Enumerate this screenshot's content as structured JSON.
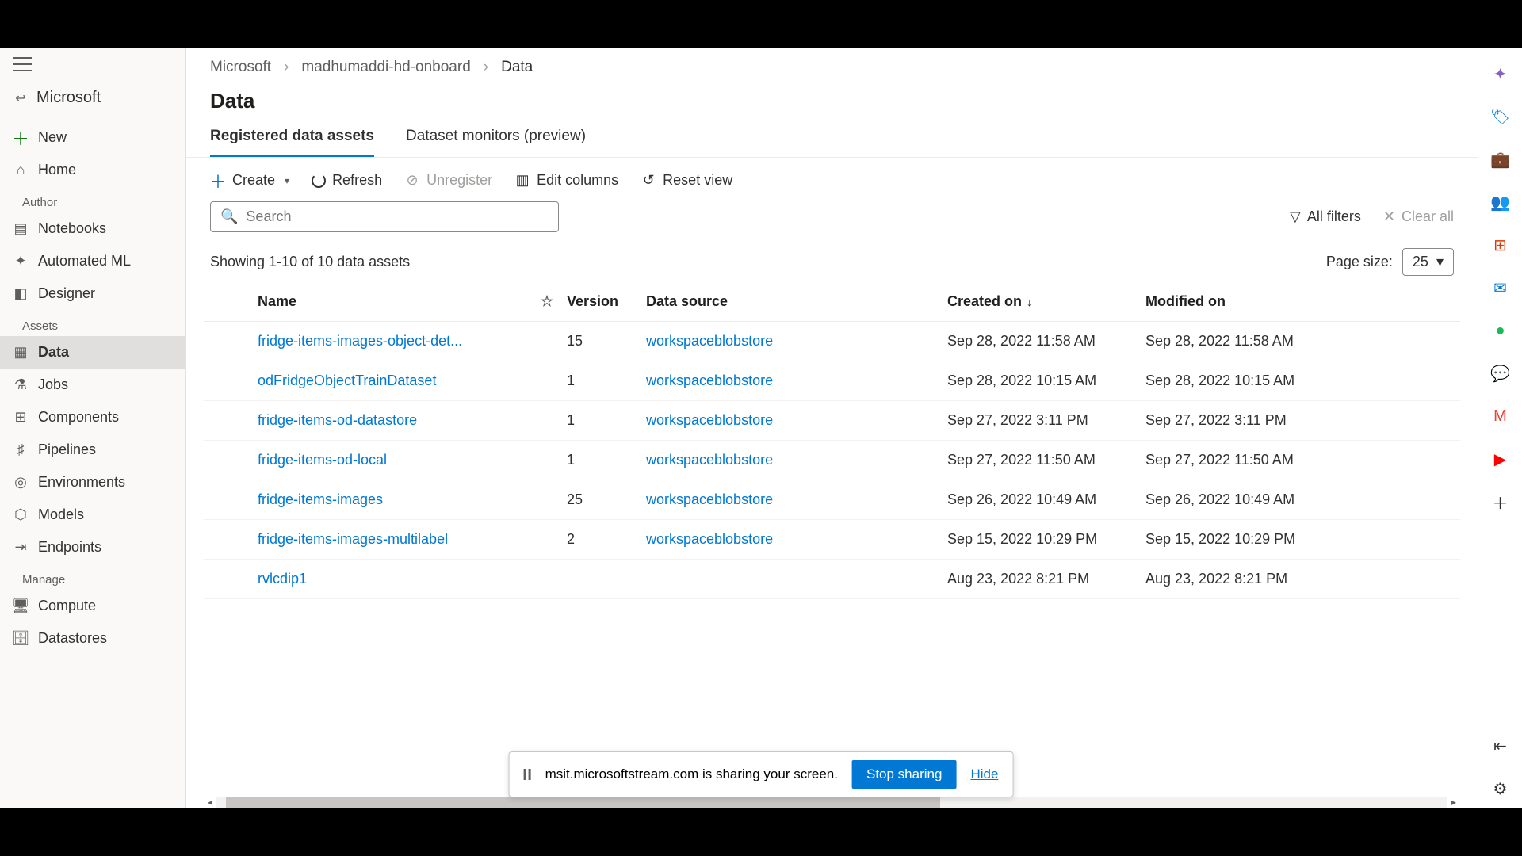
{
  "org": "Microsoft",
  "breadcrumb": {
    "root": "Microsoft",
    "workspace": "madhumaddi-hd-onboard",
    "current": "Data"
  },
  "page_title": "Data",
  "tabs": {
    "t0": "Registered data assets",
    "t1": "Dataset monitors (preview)"
  },
  "toolbar": {
    "create": "Create",
    "refresh": "Refresh",
    "unregister": "Unregister",
    "edit_columns": "Edit columns",
    "reset_view": "Reset view"
  },
  "search": {
    "placeholder": "Search"
  },
  "filters": {
    "all": "All filters",
    "clear": "Clear all"
  },
  "count_text": "Showing 1-10 of 10 data assets",
  "pagesize": {
    "label": "Page size:",
    "value": "25"
  },
  "columns": {
    "name": "Name",
    "version": "Version",
    "datasource": "Data source",
    "created": "Created on",
    "modified": "Modified on"
  },
  "rows": [
    {
      "name": "fridge-items-images-object-det...",
      "version": "15",
      "ds": "workspaceblobstore",
      "created": "Sep 28, 2022 11:58 AM",
      "modified": "Sep 28, 2022 11:58 AM"
    },
    {
      "name": "odFridgeObjectTrainDataset",
      "version": "1",
      "ds": "workspaceblobstore",
      "created": "Sep 28, 2022 10:15 AM",
      "modified": "Sep 28, 2022 10:15 AM"
    },
    {
      "name": "fridge-items-od-datastore",
      "version": "1",
      "ds": "workspaceblobstore",
      "created": "Sep 27, 2022 3:11 PM",
      "modified": "Sep 27, 2022 3:11 PM"
    },
    {
      "name": "fridge-items-od-local",
      "version": "1",
      "ds": "workspaceblobstore",
      "created": "Sep 27, 2022 11:50 AM",
      "modified": "Sep 27, 2022 11:50 AM"
    },
    {
      "name": "fridge-items-images",
      "version": "25",
      "ds": "workspaceblobstore",
      "created": "Sep 26, 2022 10:49 AM",
      "modified": "Sep 26, 2022 10:49 AM"
    },
    {
      "name": "fridge-items-images-multilabel",
      "version": "2",
      "ds": "workspaceblobstore",
      "created": "Sep 15, 2022 10:29 PM",
      "modified": "Sep 15, 2022 10:29 PM"
    },
    {
      "name": "rvlcdip1",
      "version": "",
      "ds": "",
      "created": "Aug 23, 2022 8:21 PM",
      "modified": "Aug 23, 2022 8:21 PM"
    }
  ],
  "sidebar": {
    "new": "New",
    "home": "Home",
    "author": "Author",
    "notebooks": "Notebooks",
    "automl": "Automated ML",
    "designer": "Designer",
    "assets": "Assets",
    "data": "Data",
    "jobs": "Jobs",
    "components": "Components",
    "pipelines": "Pipelines",
    "environments": "Environments",
    "models": "Models",
    "endpoints": "Endpoints",
    "manage": "Manage",
    "compute": "Compute",
    "datastores": "Datastores"
  },
  "share": {
    "msg": "msit.microsoftstream.com is sharing your screen.",
    "stop": "Stop sharing",
    "hide": "Hide"
  }
}
